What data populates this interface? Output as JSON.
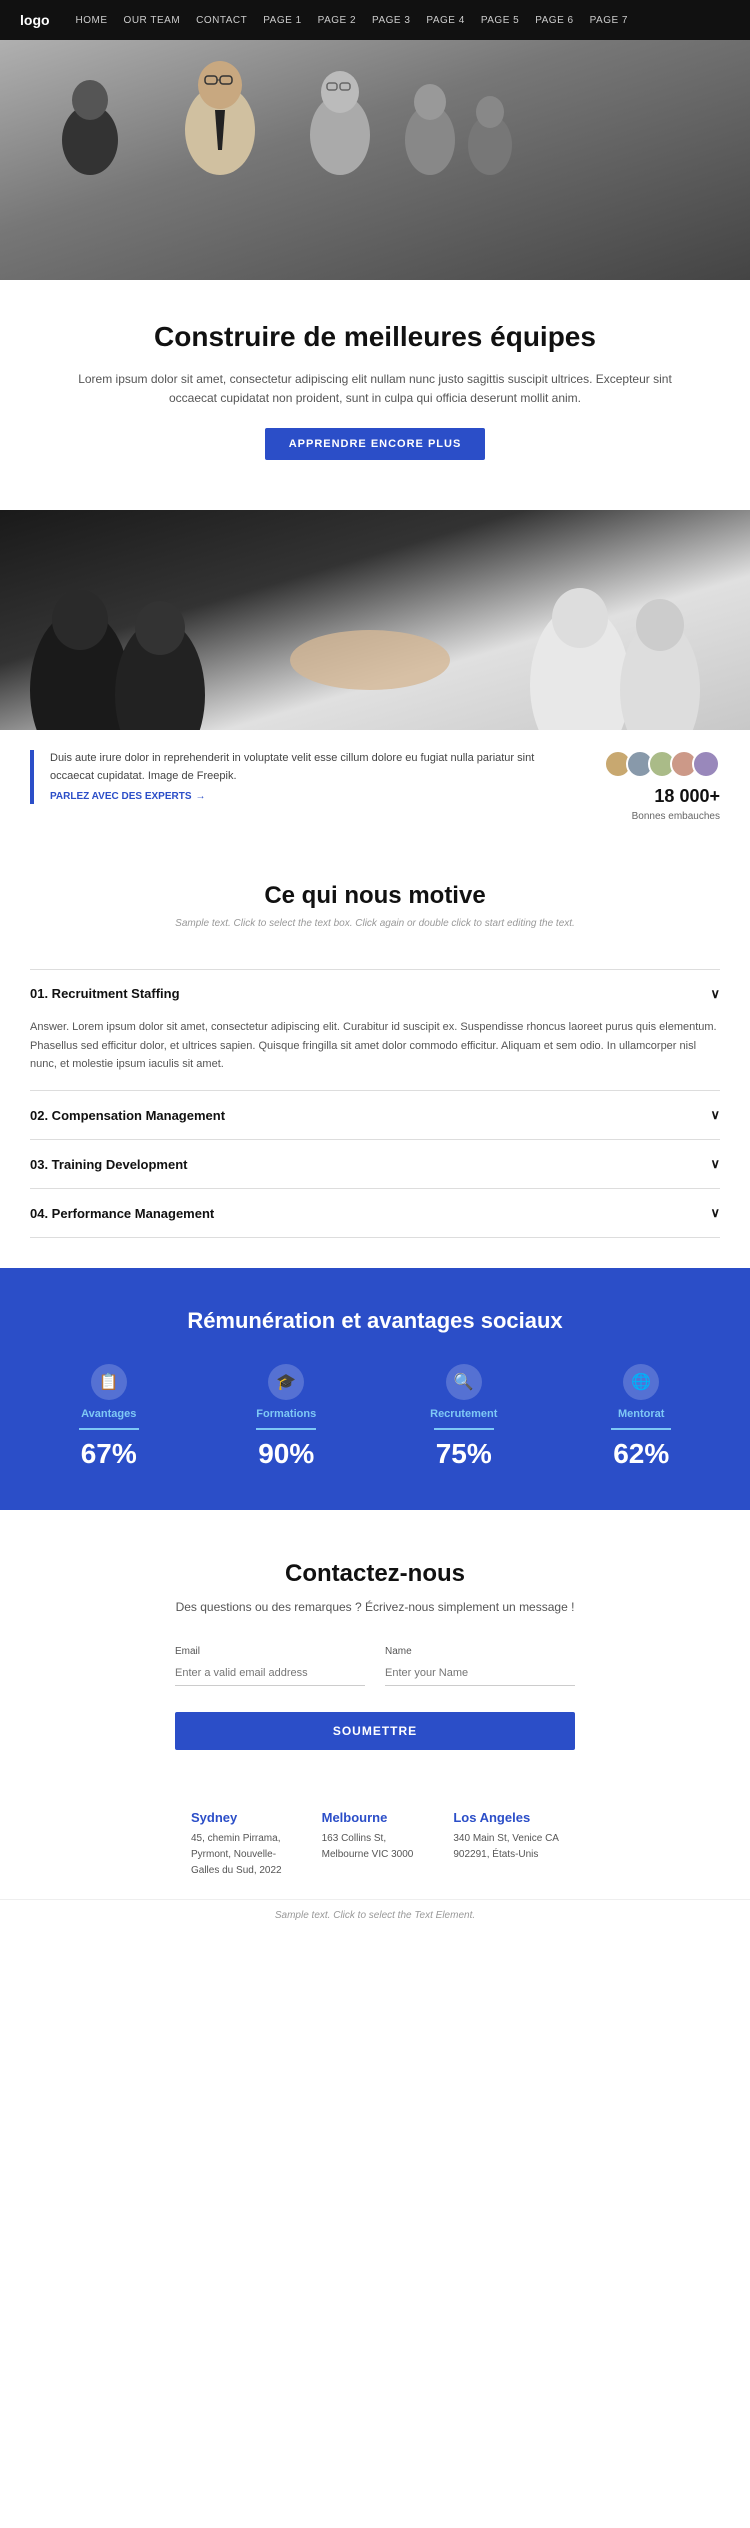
{
  "nav": {
    "logo": "logo",
    "links": [
      "HOME",
      "OUR TEAM",
      "CONTACT",
      "PAGE 1",
      "PAGE 2",
      "PAGE 3",
      "PAGE 4",
      "PAGE 5",
      "PAGE 6",
      "PAGE 7"
    ]
  },
  "hero": {
    "title": "Construire de meilleures équipes",
    "description": "Lorem ipsum dolor sit amet, consectetur adipiscing elit nullam nunc justo sagittis suscipit ultrices. Excepteur sint occaecat cupidatat non proident, sunt in culpa qui officia deserunt mollit anim.",
    "button": "APPRENDRE ENCORE PLUS"
  },
  "team_section": {
    "text": "Duis aute irure dolor in reprehenderit in voluptate velit esse cillum dolore eu fugiat nulla pariatur sint occaecat cupidatat. Image de Freepik.",
    "link": "PARLEZ AVEC DES EXPERTS",
    "stat_number": "18 000+",
    "stat_label": "Bonnes embauches"
  },
  "motivation": {
    "title": "Ce qui nous motive",
    "subtitle": "Sample text. Click to select the text box. Click again or double click to start editing the text.",
    "items": [
      {
        "number": "01.",
        "label": "Recruitment Staffing",
        "expanded": true,
        "answer": "Answer. Lorem ipsum dolor sit amet, consectetur adipiscing elit. Curabitur id suscipit ex. Suspendisse rhoncus laoreet purus quis elementum. Phasellus sed efficitur dolor, et ultrices sapien. Quisque fringilla sit amet dolor commodo efficitur. Aliquam et sem odio. In ullamcorper nisl nunc, et molestie ipsum iaculis sit amet."
      },
      {
        "number": "02.",
        "label": "Compensation Management",
        "expanded": false,
        "answer": ""
      },
      {
        "number": "03.",
        "label": "Training Development",
        "expanded": false,
        "answer": ""
      },
      {
        "number": "04.",
        "label": "Performance Management",
        "expanded": false,
        "answer": ""
      }
    ]
  },
  "blue_section": {
    "title": "Rémunération et avantages sociaux",
    "stats": [
      {
        "icon": "📋",
        "label": "Avantages",
        "pct": "67%"
      },
      {
        "icon": "🎓",
        "label": "Formations",
        "pct": "90%"
      },
      {
        "icon": "🔍",
        "label": "Recrutement",
        "pct": "75%"
      },
      {
        "icon": "🌐",
        "label": "Mentorat",
        "pct": "62%"
      }
    ]
  },
  "contact": {
    "title": "Contactez-nous",
    "subtitle": "Des questions ou des remarques ? Écrivez-nous simplement un message !",
    "email_label": "Email",
    "email_placeholder": "Enter a valid email address",
    "name_label": "Name",
    "name_placeholder": "Enter your Name",
    "button": "SOUMETTRE",
    "offices": [
      {
        "city": "Sydney",
        "address": "45, chemin Pirrama,\nPyrmont, Nouvelle-\nGalles du Sud, 2022"
      },
      {
        "city": "Melbourne",
        "address": "163 Collins St,\nMelbourne VIC 3000"
      },
      {
        "city": "Los Angeles",
        "address": "340 Main St, Venice CA\n902291, États-Unis"
      }
    ]
  },
  "footer": {
    "note": "Sample text. Click to select the Text Element."
  }
}
